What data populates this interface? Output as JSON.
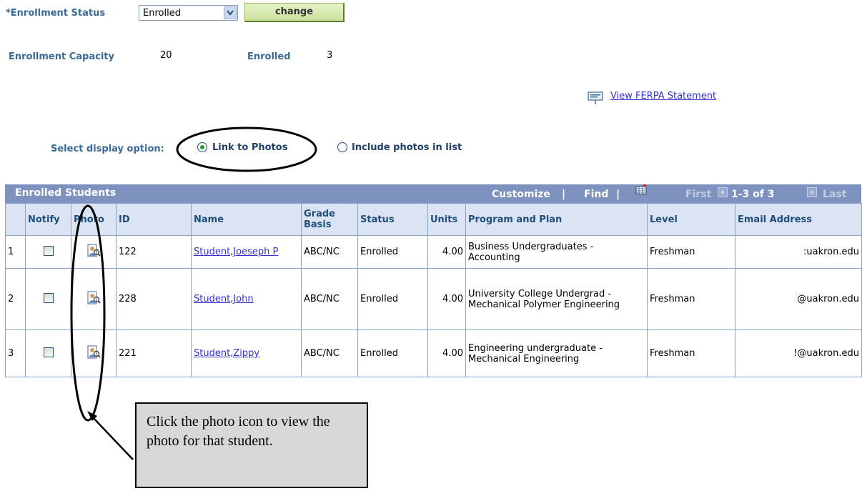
{
  "enrollment": {
    "status_label": "*Enrollment Status",
    "status_value": "Enrolled",
    "change_button": "change",
    "capacity_label": "Enrollment Capacity",
    "capacity_value": "20",
    "enrolled_label": "Enrolled",
    "enrolled_value": "3"
  },
  "ferpa_link": "View FERPA Statement",
  "display_option": {
    "label": "Select display option:",
    "options": [
      "Link to Photos",
      "Include photos in list"
    ],
    "selected": "Link to Photos"
  },
  "grid": {
    "title": "Enrolled Students",
    "customize": "Customize",
    "find": "Find",
    "first": "First",
    "range": "1-3 of 3",
    "last": "Last",
    "columns": [
      "Notify",
      "Photo",
      "ID",
      "Name",
      "Grade Basis",
      "Status",
      "Units",
      "Program and Plan",
      "Level",
      "Email Address"
    ],
    "rows": [
      {
        "num": "1",
        "id": "122",
        "name": "Student,Joeseph P",
        "grade_basis": "ABC/NC",
        "status": "Enrolled",
        "units": "4.00",
        "program": "Business Undergraduates - Accounting",
        "level": "Freshman",
        "email": ":uakron.edu"
      },
      {
        "num": "2",
        "id": "228",
        "name": "Student,John",
        "grade_basis": "ABC/NC",
        "status": "Enrolled",
        "units": "4.00",
        "program": "University College Undergrad - Mechanical Polymer Engineering",
        "level": "Freshman",
        "email": "@uakron.edu"
      },
      {
        "num": "3",
        "id": "221",
        "name": "Student,Zippy",
        "grade_basis": "ABC/NC",
        "status": "Enrolled",
        "units": "4.00",
        "program": "Engineering undergraduate - Mechanical Engineering",
        "level": "Freshman",
        "email": "!@uakron.edu"
      }
    ]
  },
  "callout": "Click the photo icon to view the photo for that student.",
  "icons": [
    "dropdown-arrow-icon",
    "ferpa-icon",
    "grid-icon",
    "first-arrow-icon",
    "last-arrow-icon",
    "photo-icon",
    "checkbox"
  ],
  "colors": {
    "label": "#3a6a96",
    "grid_header": "#7d92bf",
    "link": "#3333cc",
    "column_header": "#dbe4f3"
  }
}
